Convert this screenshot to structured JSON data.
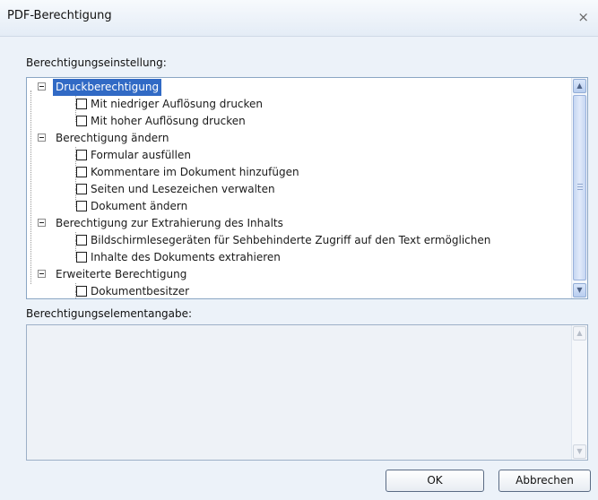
{
  "window": {
    "title": "PDF-Berechtigung",
    "close_glyph": "×"
  },
  "settings_label": "Berechtigungseinstellung:",
  "tree": {
    "groups": [
      {
        "label": "Druckberechtigung",
        "selected": true,
        "items": [
          "Mit niedriger Auflösung drucken",
          "Mit hoher Auflösung drucken"
        ]
      },
      {
        "label": "Berechtigung ändern",
        "items": [
          "Formular ausfüllen",
          "Kommentare im Dokument hinzufügen",
          "Seiten und Lesezeichen verwalten",
          "Dokument ändern"
        ]
      },
      {
        "label": "Berechtigung zur Extrahierung des Inhalts",
        "items": [
          "Bildschirmlesegeräten für Sehbehinderte Zugriff auf den Text ermöglichen",
          "Inhalte des Dokuments extrahieren"
        ]
      },
      {
        "label": "Erweiterte Berechtigung",
        "items": [
          "Dokumentbesitzer"
        ]
      }
    ]
  },
  "description_label": "Berechtigungselementangabe:",
  "buttons": {
    "ok": "OK",
    "cancel": "Abbrechen"
  },
  "icons": {
    "close": "close-icon",
    "scroll_up": "chevron-up-icon",
    "scroll_down": "chevron-down-icon",
    "expander": "collapse-minus-icon"
  }
}
